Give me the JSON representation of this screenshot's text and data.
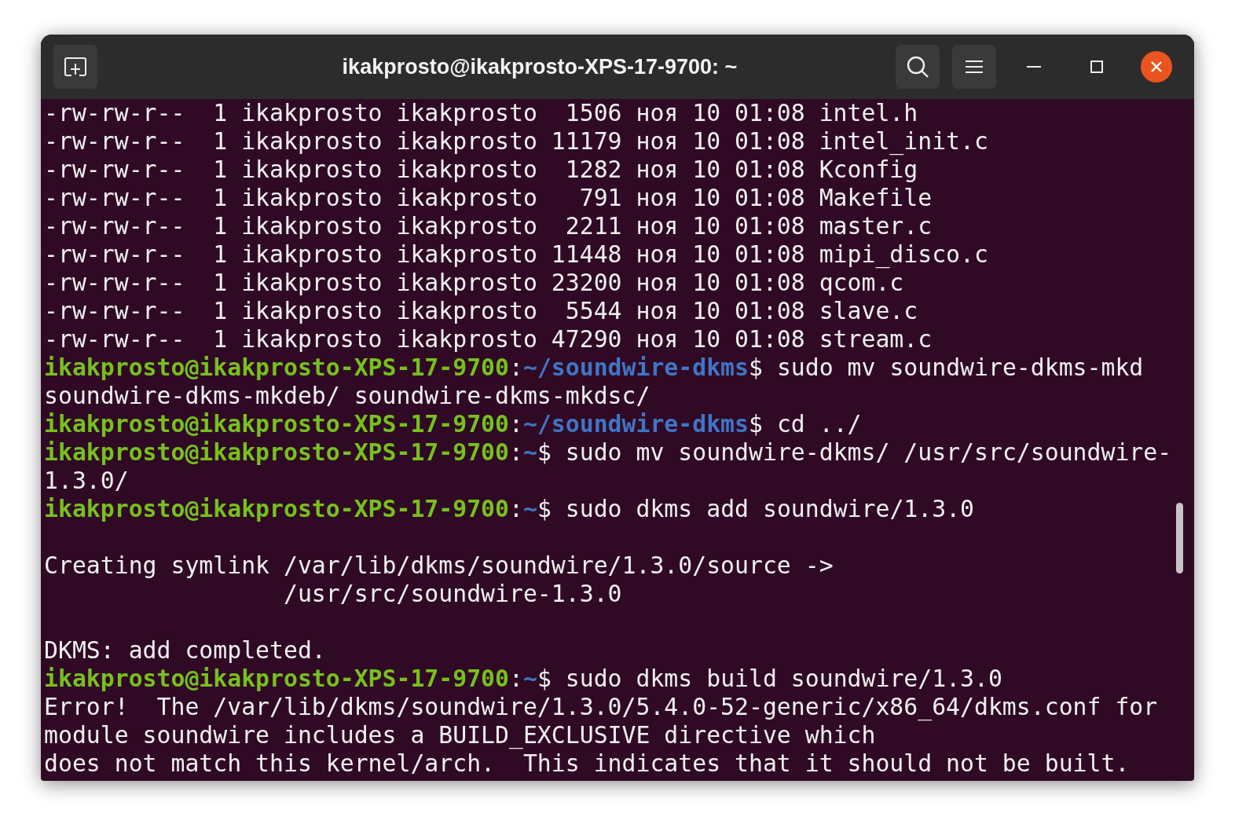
{
  "window": {
    "title": "ikakprosto@ikakprosto-XPS-17-9700: ~"
  },
  "lines": [
    {
      "kind": "output",
      "text": "-rw-rw-r--  1 ikakprosto ikakprosto  1506 ноя 10 01:08 intel.h"
    },
    {
      "kind": "output",
      "text": "-rw-rw-r--  1 ikakprosto ikakprosto 11179 ноя 10 01:08 intel_init.c"
    },
    {
      "kind": "output",
      "text": "-rw-rw-r--  1 ikakprosto ikakprosto  1282 ноя 10 01:08 Kconfig"
    },
    {
      "kind": "output",
      "text": "-rw-rw-r--  1 ikakprosto ikakprosto   791 ноя 10 01:08 Makefile"
    },
    {
      "kind": "output",
      "text": "-rw-rw-r--  1 ikakprosto ikakprosto  2211 ноя 10 01:08 master.c"
    },
    {
      "kind": "output",
      "text": "-rw-rw-r--  1 ikakprosto ikakprosto 11448 ноя 10 01:08 mipi_disco.c"
    },
    {
      "kind": "output",
      "text": "-rw-rw-r--  1 ikakprosto ikakprosto 23200 ноя 10 01:08 qcom.c"
    },
    {
      "kind": "output",
      "text": "-rw-rw-r--  1 ikakprosto ikakprosto  5544 ноя 10 01:08 slave.c"
    },
    {
      "kind": "output",
      "text": "-rw-rw-r--  1 ikakprosto ikakprosto 47290 ноя 10 01:08 stream.c"
    },
    {
      "kind": "prompt",
      "user": "ikakprosto@ikakprosto-XPS-17-9700",
      "separator": ":",
      "path": "~/soundwire-dkms",
      "symbol": "$",
      "command": "sudo mv soundwire-dkms-mkd"
    },
    {
      "kind": "output",
      "text": "soundwire-dkms-mkdeb/ soundwire-dkms-mkdsc/"
    },
    {
      "kind": "prompt",
      "user": "ikakprosto@ikakprosto-XPS-17-9700",
      "separator": ":",
      "path": "~/soundwire-dkms",
      "symbol": "$",
      "command": "cd ../"
    },
    {
      "kind": "prompt",
      "user": "ikakprosto@ikakprosto-XPS-17-9700",
      "separator": ":",
      "path": "~",
      "symbol": "$",
      "command": "sudo mv soundwire-dkms/ /usr/src/soundwire-"
    },
    {
      "kind": "output",
      "text": "1.3.0/"
    },
    {
      "kind": "prompt",
      "user": "ikakprosto@ikakprosto-XPS-17-9700",
      "separator": ":",
      "path": "~",
      "symbol": "$",
      "command": "sudo dkms add soundwire/1.3.0"
    },
    {
      "kind": "blank"
    },
    {
      "kind": "output",
      "text": "Creating symlink /var/lib/dkms/soundwire/1.3.0/source ->"
    },
    {
      "kind": "output",
      "text": "                 /usr/src/soundwire-1.3.0"
    },
    {
      "kind": "blank"
    },
    {
      "kind": "output",
      "text": "DKMS: add completed."
    },
    {
      "kind": "prompt",
      "user": "ikakprosto@ikakprosto-XPS-17-9700",
      "separator": ":",
      "path": "~",
      "symbol": "$",
      "command": "sudo dkms build soundwire/1.3.0"
    },
    {
      "kind": "output",
      "text": "Error!  The /var/lib/dkms/soundwire/1.3.0/5.4.0-52-generic/x86_64/dkms.conf for"
    },
    {
      "kind": "output",
      "text": "module soundwire includes a BUILD_EXCLUSIVE directive which"
    },
    {
      "kind": "output",
      "text": "does not match this kernel/arch.  This indicates that it should not be built."
    }
  ]
}
